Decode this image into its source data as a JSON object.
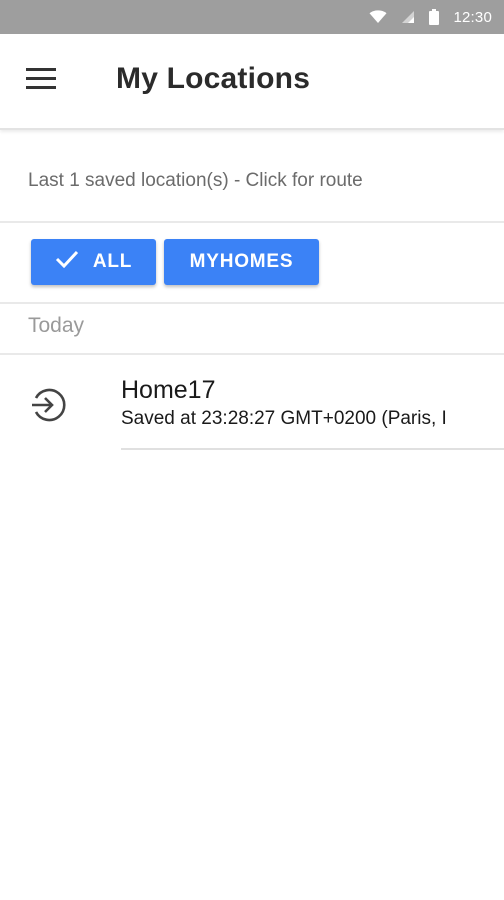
{
  "status_bar": {
    "time": "12:30",
    "icons": [
      "wifi-icon",
      "cell-signal-icon",
      "battery-icon"
    ]
  },
  "app_bar": {
    "title": "My Locations",
    "menu_icon": "hamburger-menu-icon"
  },
  "info": {
    "text": "Last 1 saved location(s) - Click for route"
  },
  "filters": {
    "all_label": "ALL",
    "all_icon": "check-icon",
    "myhomes_label": "MYHOMES"
  },
  "section": {
    "header": "Today"
  },
  "locations": [
    {
      "title": "Home17",
      "subtitle": "Saved at 23:28:27 GMT+0200 (Paris, I",
      "icon": "login-arrow-icon"
    }
  ],
  "colors": {
    "accent": "#3b82f6",
    "status_bar": "#9e9e9e",
    "title_text": "#2b2b2b",
    "muted_text": "#9a9a9a"
  }
}
